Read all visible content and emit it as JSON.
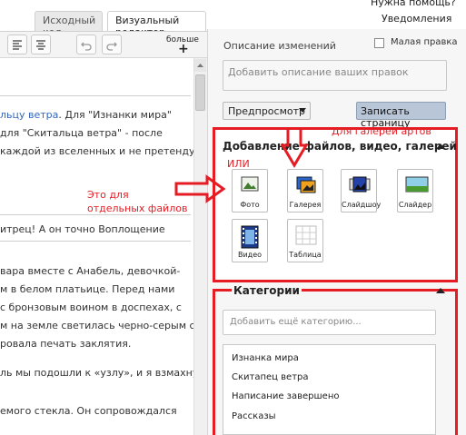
{
  "header": {
    "help": "Нужна помощь?",
    "notifications": "Уведомления"
  },
  "tabs": [
    {
      "label": "Исходный код"
    },
    {
      "label": "Визуальный редактор"
    }
  ],
  "toolbar": {
    "more_label": "больше",
    "more_plus": "+"
  },
  "editor": {
    "lines": [
      {
        "pre": "",
        "link": "льцу ветра",
        "post": ". Для \"Изнанки мира\""
      },
      {
        "pre": "для \"Скитальца ветра\" - после",
        "link": "",
        "post": ""
      },
      {
        "pre": "каждой из вселенных и не претендует",
        "link": "",
        "post": ""
      },
      {
        "pre": "итрец! А он точно Воплощение",
        "link": "",
        "post": ""
      },
      {
        "pre": "вара вместе с Анабель, девочкой-",
        "link": "",
        "post": ""
      },
      {
        "pre": "м в белом платьице. Перед нами",
        "link": "",
        "post": ""
      },
      {
        "pre": "с бронзовым воином в доспехах, с",
        "link": "",
        "post": ""
      },
      {
        "pre": "м на земле светилась черно-серым с",
        "link": "",
        "post": ""
      },
      {
        "pre": "ровала печать заклятия.",
        "link": "",
        "post": ""
      },
      {
        "pre": "ль мы подошли к «узлу», и я взмахнул",
        "link": "",
        "post": ""
      },
      {
        "pre": "емого стекла. Он сопровождался",
        "link": "",
        "post": ""
      }
    ]
  },
  "summary": {
    "label": "Описание изменений",
    "minor_edit": "Малая правка",
    "placeholder": "Добавить описание ваших правок"
  },
  "actions": {
    "preview": "Предпросмотр",
    "save": "Записать страницу"
  },
  "gallery": {
    "title": "Добавление файлов, видео, галерей",
    "buttons": [
      {
        "label": "Фото",
        "icon": "photo-icon"
      },
      {
        "label": "Галерея",
        "icon": "gallery-icon"
      },
      {
        "label": "Слайдшоу",
        "icon": "slideshow-icon"
      },
      {
        "label": "Слайдер",
        "icon": "slider-icon"
      },
      {
        "label": "Видео",
        "icon": "video-icon"
      },
      {
        "label": "Таблица",
        "icon": "table-icon"
      }
    ]
  },
  "annotations": {
    "or": "ИЛИ",
    "for_gallery": "Для галереи артов",
    "for_single_line1": "Это для",
    "for_single_line2": "отдельных файлов",
    "red": "#e51c23"
  },
  "categories": {
    "title": "Категории",
    "placeholder": "Добавить ещё категорию...",
    "items": [
      "Изнанка мира",
      "Скитапец ветра",
      "Написание завершено",
      "Рассказы"
    ]
  }
}
